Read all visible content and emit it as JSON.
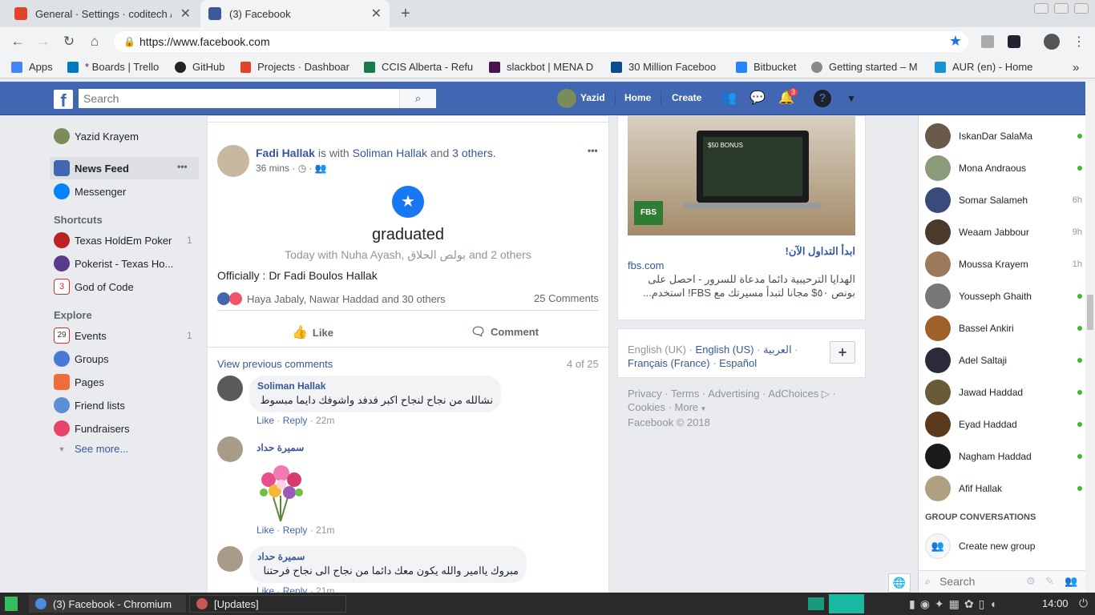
{
  "tabs": [
    {
      "title": "General · Settings · coditech /",
      "close": "✕"
    },
    {
      "title": "(3) Facebook",
      "close": "✕"
    }
  ],
  "new_tab": "+",
  "url": "https://www.facebook.com",
  "bookmarks": [
    "Apps",
    "* Boards | Trello",
    "GitHub",
    "Projects · Dashboar",
    "CCIS Alberta - Refu",
    "slackbot | MENA D",
    "30 Million Faceboo",
    "Bitbucket",
    "Getting started – M",
    "AUR (en) - Home"
  ],
  "fb_header": {
    "logo": "f",
    "search_placeholder": "Search",
    "user": "Yazid",
    "home": "Home",
    "create": "Create",
    "notif_count": "3"
  },
  "left_nav": {
    "profile": "Yazid Krayem",
    "news_feed": "News Feed",
    "news_feed_more": "•••",
    "messenger": "Messenger",
    "shortcuts_label": "Shortcuts",
    "shortcuts": [
      {
        "label": "Texas HoldEm Poker",
        "count": "1"
      },
      {
        "label": "Pokerist - Texas Ho...",
        "count": ""
      },
      {
        "label": "God of Code",
        "count": ""
      }
    ],
    "explore_label": "Explore",
    "explore": [
      {
        "label": "Events",
        "count": "1"
      },
      {
        "label": "Groups",
        "count": ""
      },
      {
        "label": "Pages",
        "count": ""
      },
      {
        "label": "Friend lists",
        "count": ""
      },
      {
        "label": "Fundraisers",
        "count": ""
      }
    ],
    "see_more": "See more..."
  },
  "post": {
    "author": "Fadi Hallak",
    "is_with": "is with",
    "with_name": "Soliman Hallak",
    "and": "and",
    "others": "3 others.",
    "time": "36 mins",
    "dot": "·",
    "options": "•••",
    "event_title": "graduated",
    "event_sub": "Today with Nuha Ayash, بولص الحلاق and 2 others",
    "text": "Officially : Dr Fadi Boulos Hallak",
    "reactions": "Haya Jabaly, Nawar Haddad and 30 others",
    "comments_count": "25 Comments",
    "like": "Like",
    "comment": "Comment",
    "view_previous": "View previous comments",
    "paging": "4 of 25"
  },
  "comments": [
    {
      "author": "Soliman Hallak",
      "text": "نشالله من نجاح لنجاح اكبر فدفد واشوفك دايما مبسوط",
      "like": "Like",
      "reply": "Reply",
      "time": "22m"
    },
    {
      "author": "سميرة حداد",
      "text": "",
      "like": "Like",
      "reply": "Reply",
      "time": "21m"
    },
    {
      "author": "سميرة حداد",
      "text": "مبروك ياامير والله يكون معك دائما من نجاح الى نجاح فرحتنا",
      "like": "Like",
      "reply": "Reply",
      "time": "21m"
    }
  ],
  "ad": {
    "image_text_1": "$50 BONUS",
    "image_text_2": "FBS",
    "headline": "ابدأ التداول الآن!",
    "domain": "fbs.com",
    "body": "الهدايا الترحيبية دائما مدعاة للسرور - احصل على بونص ٥٠$ مجانا لتبدأ مسيرتك مع FBS! استخدم..."
  },
  "languages": {
    "items": [
      "English (UK)",
      "English (US)",
      "العربية",
      "Français (France)",
      "Español"
    ],
    "add": "+"
  },
  "footer": {
    "links": [
      "Privacy",
      "Terms",
      "Advertising",
      "AdChoices",
      "Cookies",
      "More"
    ],
    "copyright": "Facebook © 2018"
  },
  "chat": {
    "contacts": [
      {
        "name": "IskanDar SalaMa",
        "status": "online"
      },
      {
        "name": "Mona Andraous",
        "status": "online"
      },
      {
        "name": "Somar Salameh",
        "status": "6h"
      },
      {
        "name": "Weaam Jabbour",
        "status": "9h"
      },
      {
        "name": "Moussa Krayem",
        "status": "1h"
      },
      {
        "name": "Yousseph Ghaith",
        "status": "online"
      },
      {
        "name": "Bassel Ankiri",
        "status": "online"
      },
      {
        "name": "Adel Saltaji",
        "status": "online"
      },
      {
        "name": "Jawad Haddad",
        "status": "online"
      },
      {
        "name": "Eyad Haddad",
        "status": "online"
      },
      {
        "name": "Nagham Haddad",
        "status": "online"
      },
      {
        "name": "Afif Hallak",
        "status": "online"
      }
    ],
    "group_label": "GROUP CONVERSATIONS",
    "create_group": "Create new group",
    "search_placeholder": "Search"
  },
  "taskbar": {
    "windows": [
      "(3) Facebook - Chromium",
      "[Updates]"
    ],
    "clock": "14:00"
  },
  "colors": {
    "fb_blue": "#4267b2",
    "link": "#365899",
    "online": "#42b72a"
  }
}
